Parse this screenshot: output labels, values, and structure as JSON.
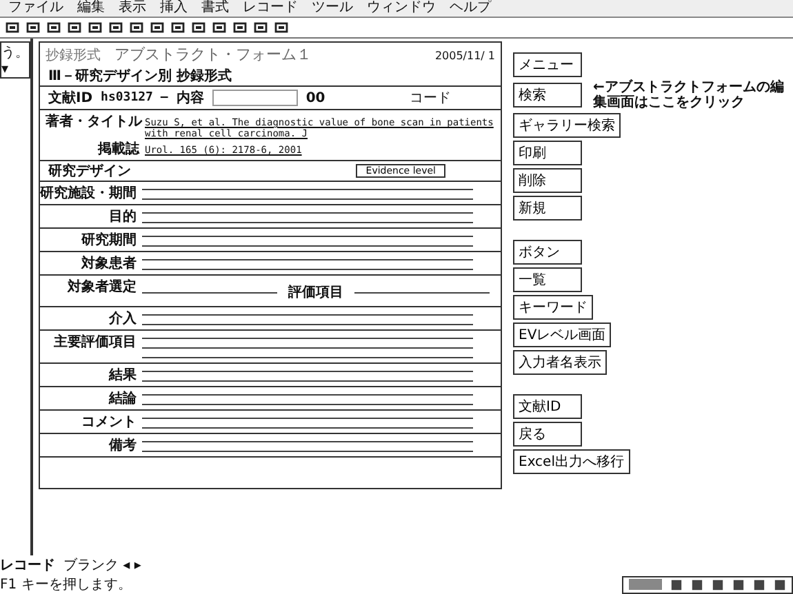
{
  "menu": [
    "ファイル",
    "編集",
    "表示",
    "挿入",
    "書式",
    "レコード",
    "ツール",
    "ウィンドウ",
    "ヘルプ"
  ],
  "left_pane": {
    "dropdown": "う。",
    "arrow": "▾"
  },
  "form": {
    "caption": "抄録形式",
    "title": "アブストラクト・フォーム１",
    "date": "2005/11/ 1",
    "section": "Ⅲ－研究デザイン別 抄録形式",
    "id_label": "文献ID",
    "id_value": "hs03127",
    "id_dash": "—",
    "content_label": "内容",
    "code_value": "00",
    "code_label": "コード",
    "refs": [
      {
        "label": "著者・タイトル",
        "value": "Suzu S, et al. The diagnostic value of bone scan in patients with renal cell carcinoma. J"
      },
      {
        "label": "掲載誌",
        "value": "Urol. 165 (6): 2178-6, 2001"
      }
    ],
    "design_label": "研究デザイン",
    "evidence_button": "Evidence level",
    "fields": [
      {
        "label": "研究施設・期間",
        "kind": "double"
      },
      {
        "label": "目的",
        "kind": "double"
      },
      {
        "label": "研究期間",
        "kind": "double"
      },
      {
        "label": "対象患者",
        "kind": "double"
      },
      {
        "label": "対象者選定",
        "label2": "評価項目",
        "kind": "split"
      },
      {
        "label": "介入",
        "kind": "double"
      },
      {
        "label": "主要評価項目",
        "kind": "triple"
      },
      {
        "label": "結果",
        "kind": "double"
      },
      {
        "label": "結論",
        "kind": "double"
      },
      {
        "label": "コメント",
        "kind": "double"
      },
      {
        "label": "備考",
        "kind": "double"
      }
    ]
  },
  "button_groups": [
    [
      {
        "label": "メニュー"
      },
      {
        "label": "検索",
        "note": "←アブストラクトフォームの編集画面はここをクリック"
      },
      {
        "label": "ギャラリー検索"
      },
      {
        "label": "印刷"
      },
      {
        "label": "削除"
      },
      {
        "label": "新規"
      }
    ],
    [
      {
        "label": "ボタン"
      },
      {
        "label": "一覧"
      },
      {
        "label": "キーワード"
      },
      {
        "label": "EVレベル画面"
      },
      {
        "label": "入力者名表示"
      }
    ],
    [
      {
        "label": "文献ID"
      },
      {
        "label": "戻る"
      },
      {
        "label": "Excel出力へ移行"
      }
    ]
  ],
  "record_nav": {
    "label": "レコード",
    "value": "ブランク",
    "arrows": "◂ ▸"
  },
  "status": "F1 キーを押します。"
}
